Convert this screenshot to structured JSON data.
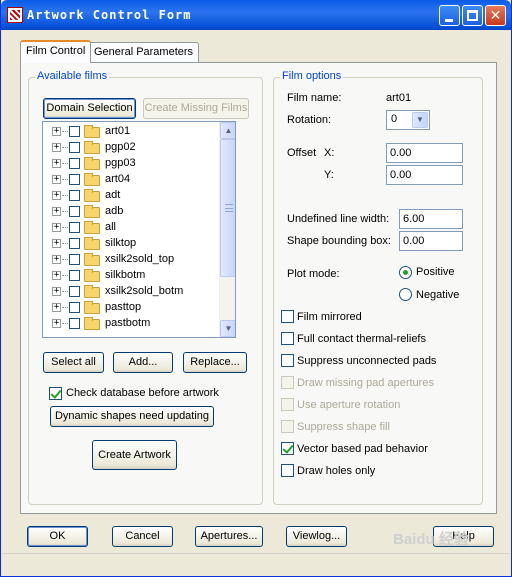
{
  "window": {
    "title": "Artwork Control Form"
  },
  "tabs": [
    {
      "label": "Film Control"
    },
    {
      "label": "General Parameters"
    }
  ],
  "available_films": {
    "group_title": "Available films",
    "domain_selection_label": "Domain Selection",
    "create_missing_label": "Create Missing Films",
    "films": [
      "art01",
      "pgp02",
      "pgp03",
      "art04",
      "adt",
      "adb",
      "all",
      "silktop",
      "xsilk2sold_top",
      "silkbotm",
      "xsilk2sold_botm",
      "pasttop",
      "pastbotm"
    ],
    "expander_symbol": "+",
    "select_all_label": "Select all",
    "add_label": "Add...",
    "replace_label": "Replace...",
    "check_db_label": "Check database before artwork",
    "check_db_checked": true,
    "dynamic_shapes_label": "Dynamic shapes need updating",
    "create_artwork_label": "Create Artwork"
  },
  "film_options": {
    "group_title": "Film options",
    "film_name_label": "Film name:",
    "film_name_value": "art01",
    "rotation_label": "Rotation:",
    "rotation_value": "0",
    "offset_label": "Offset",
    "offset_x_label": "X:",
    "offset_x_value": "0.00",
    "offset_y_label": "Y:",
    "offset_y_value": "0.00",
    "undefined_line_width_label": "Undefined line width:",
    "undefined_line_width_value": "6.00",
    "shape_bounding_box_label": "Shape bounding box:",
    "shape_bounding_box_value": "0.00",
    "plot_mode_label": "Plot mode:",
    "positive_label": "Positive",
    "negative_label": "Negative",
    "plot_mode_selected": "Positive",
    "options": [
      {
        "label": "Film mirrored",
        "checked": false,
        "enabled": true
      },
      {
        "label": "Full contact thermal-reliefs",
        "checked": false,
        "enabled": true
      },
      {
        "label": "Suppress unconnected pads",
        "checked": false,
        "enabled": true
      },
      {
        "label": "Draw missing pad apertures",
        "checked": false,
        "enabled": false
      },
      {
        "label": "Use aperture rotation",
        "checked": false,
        "enabled": false
      },
      {
        "label": "Suppress shape fill",
        "checked": false,
        "enabled": false
      },
      {
        "label": "Vector based pad behavior",
        "checked": true,
        "enabled": true
      },
      {
        "label": "Draw holes only",
        "checked": false,
        "enabled": true
      }
    ]
  },
  "footer": {
    "ok_label": "OK",
    "cancel_label": "Cancel",
    "apertures_label": "Apertures...",
    "viewlog_label": "Viewlog...",
    "help_label": "Help"
  },
  "watermark": "Baidu 经验"
}
